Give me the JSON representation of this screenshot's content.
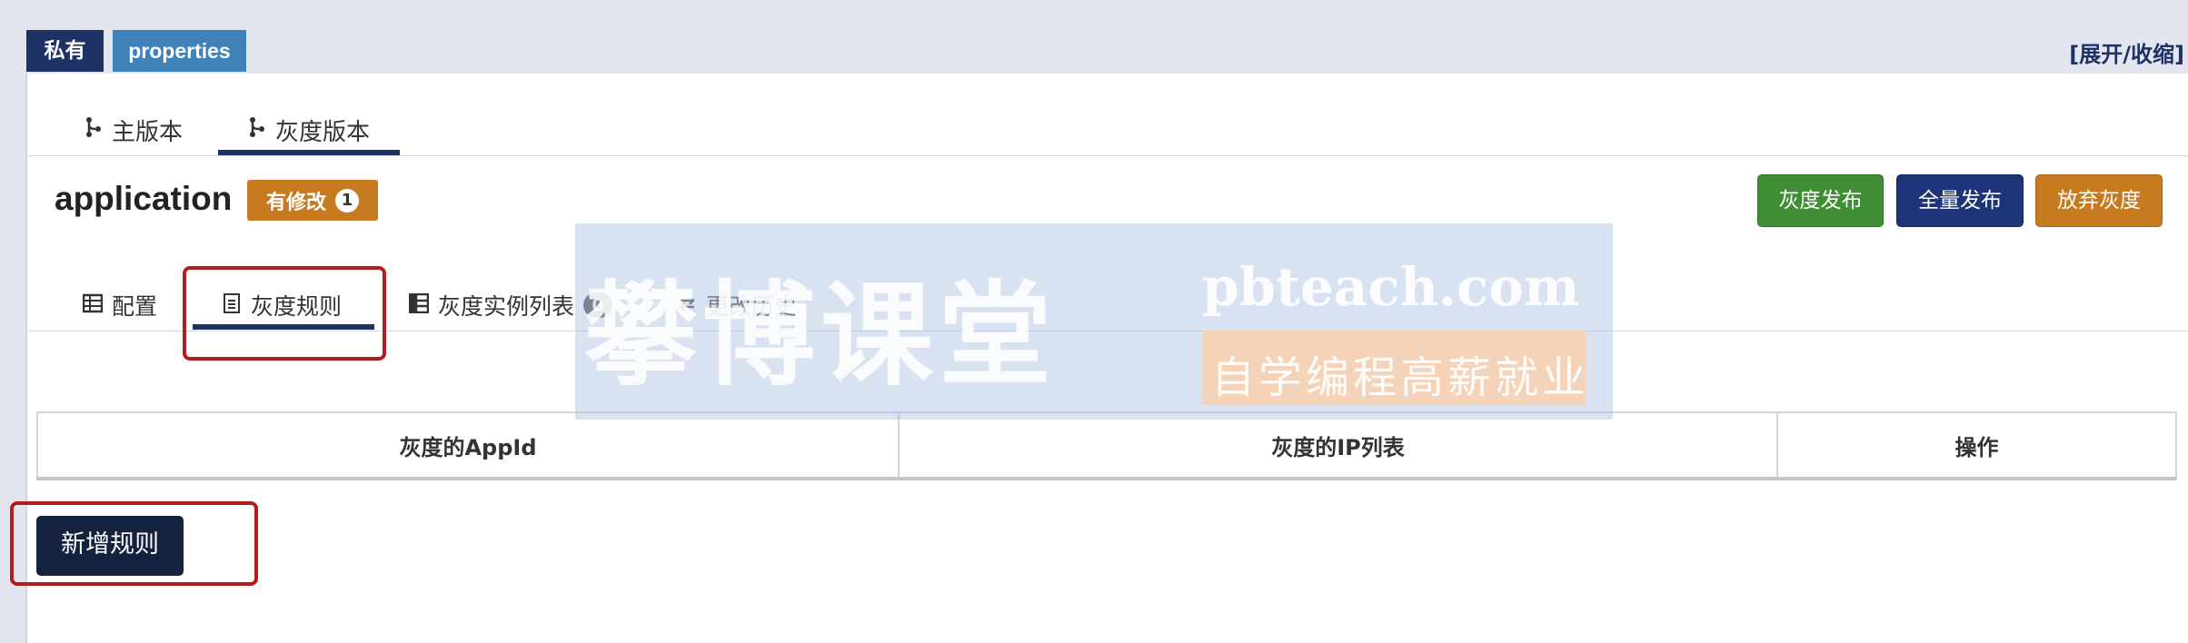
{
  "header": {
    "scope_badge": "私有",
    "format_badge": "properties",
    "toggle_label": "[展开/收缩]"
  },
  "branch_tabs": [
    {
      "label": "主版本",
      "icon": "branch-icon"
    },
    {
      "label": "灰度版本",
      "icon": "branch-icon",
      "active": true
    }
  ],
  "namespace": {
    "name": "application",
    "modified_label": "有修改",
    "modified_count": "1"
  },
  "actions": {
    "gray_release": "灰度发布",
    "full_release": "全量发布",
    "abandon_gray": "放弃灰度"
  },
  "sub_tabs": {
    "config": "配置",
    "rules": "灰度规则",
    "instances": "灰度实例列表",
    "instances_count": "0",
    "history": "更改历史"
  },
  "rules_table": {
    "columns": [
      "灰度的AppId",
      "灰度的IP列表",
      "操作"
    ]
  },
  "add_rule_label": "新增规则",
  "watermark": {
    "brand": "攀博课堂",
    "url": "pbteach.com",
    "slogan": "自学编程高薪就业"
  },
  "colors": {
    "navy": "#1e3266",
    "green": "#3f8d35",
    "orange": "#c77b21",
    "highlight_red": "#b21e1e"
  }
}
